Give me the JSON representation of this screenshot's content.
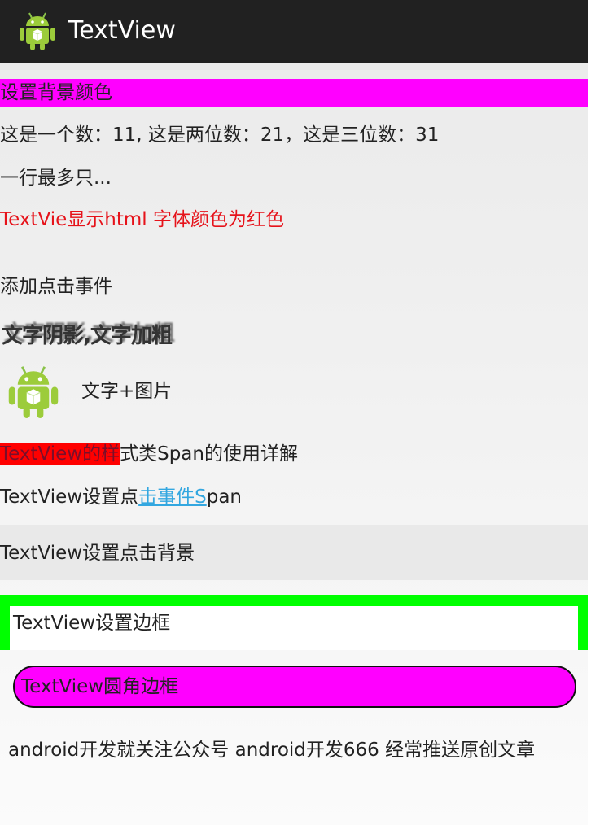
{
  "app_bar": {
    "title": "TextView",
    "icon": "android-icon"
  },
  "rows": {
    "bg_color_text": "设置背景颜色",
    "numbers_text": "这是一个数：11, 这是两位数：21，这是三位数：31",
    "ellipsis_text": "一行最多只...",
    "html_red_text": "TextVie显示html 字体颜色为红色",
    "click_event_text": "添加点击事件",
    "shadow_text": "文字阴影,文字加粗",
    "text_image_text": "文字+图片",
    "span_highlight": "TextView的样",
    "span_rest": "式类Span的使用详解",
    "click_span_prefix": "TextView设置点",
    "click_span_link": "击事件S",
    "click_span_suffix": "pan",
    "click_bg_text": "TextView设置点击背景",
    "border_text": "TextView设置边框",
    "round_border_text": "TextView圆角边框",
    "marquee_text": "android开发就关注公众号  android开发666 经常推送原创文章"
  },
  "colors": {
    "magenta": "#ff00ff",
    "red_text": "#e6121a",
    "span_bg": "#ff0000",
    "link": "#33a7e0",
    "border_green": "#00ff00",
    "action_bar": "#212121"
  }
}
